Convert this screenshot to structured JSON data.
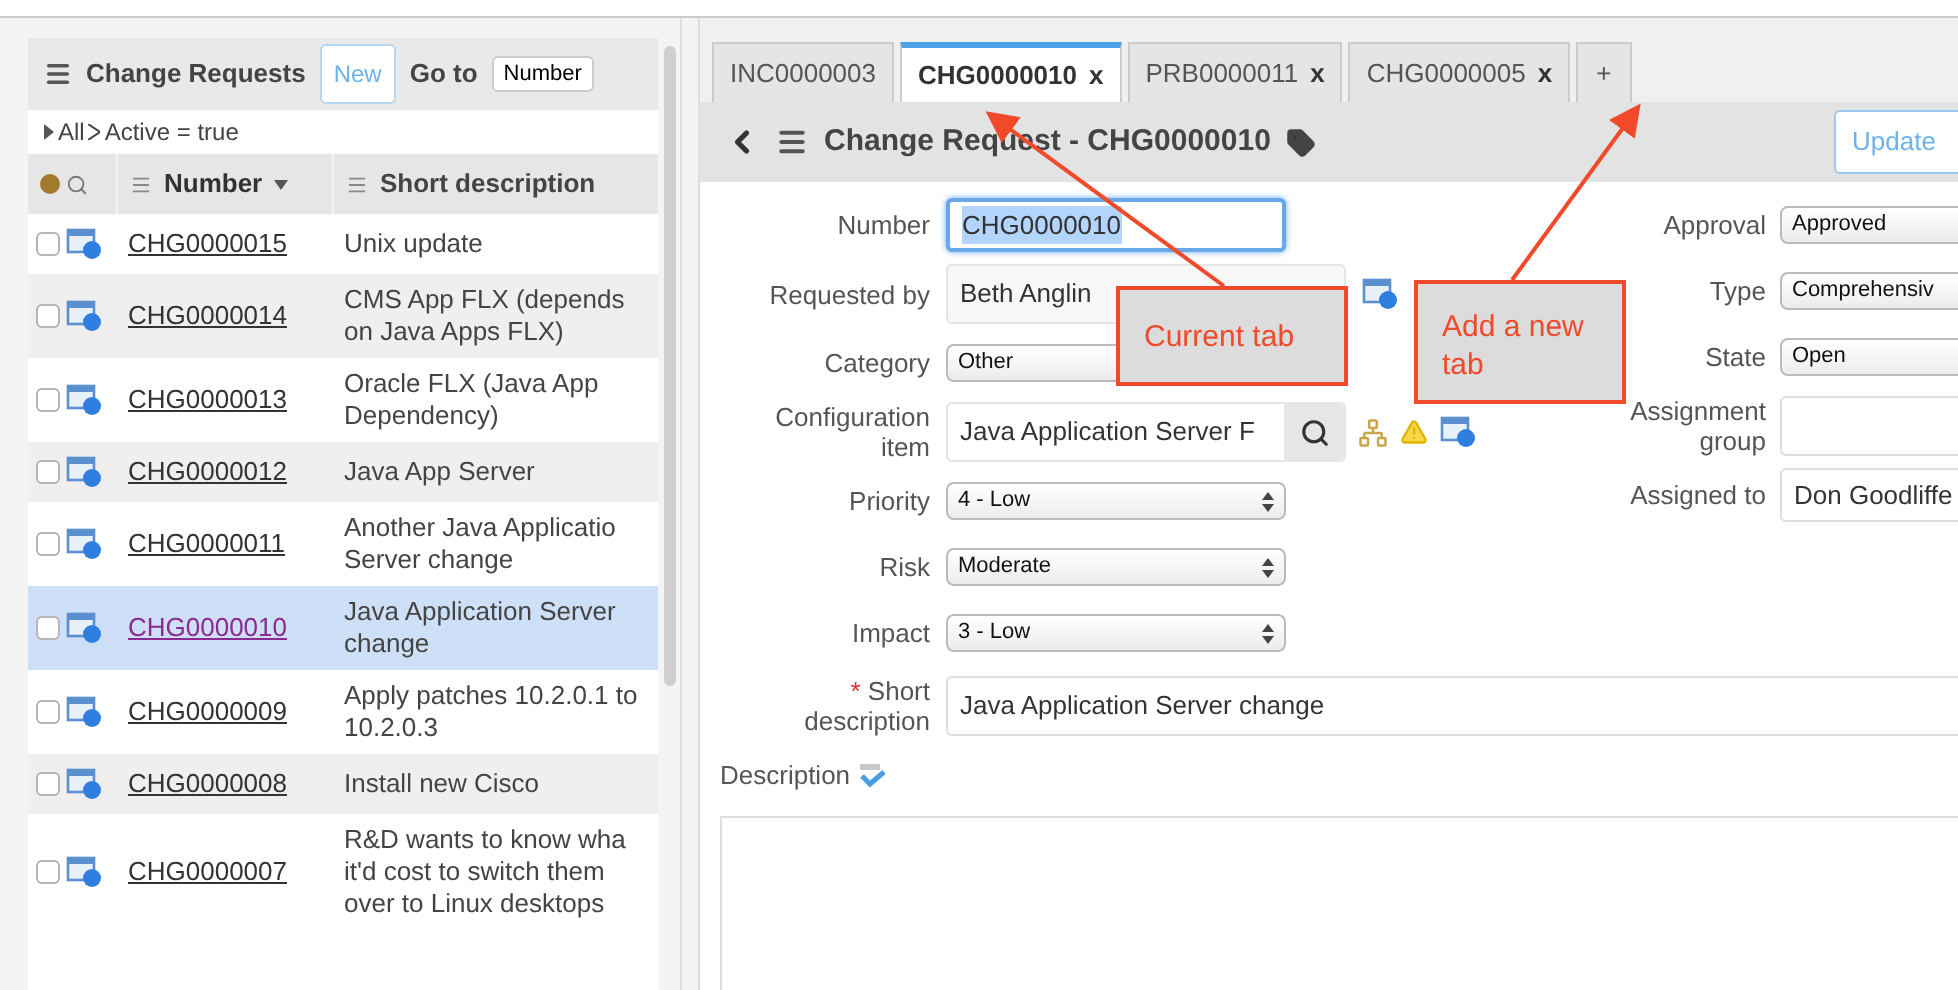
{
  "list": {
    "title": "Change Requests",
    "new_button": "New",
    "goto_label": "Go to",
    "goto_select": "Number",
    "breadcrumb": [
      {
        "label": "All"
      },
      {
        "label": "Active = true"
      }
    ],
    "columns": [
      {
        "label": "Number",
        "sorted": true
      },
      {
        "label": "Short description",
        "sorted": false
      }
    ],
    "rows": [
      {
        "number": "CHG0000015",
        "description": "Unix update",
        "selected": false
      },
      {
        "number": "CHG0000014",
        "description": "CMS App FLX (depends on Java Apps FLX)",
        "selected": false
      },
      {
        "number": "CHG0000013",
        "description": "Oracle FLX (Java App Dependency)",
        "selected": false
      },
      {
        "number": "CHG0000012",
        "description": "Java App Server",
        "selected": false
      },
      {
        "number": "CHG0000011",
        "description": "Another Java Applicatio Server change",
        "selected": false
      },
      {
        "number": "CHG0000010",
        "description": "Java Application Server change",
        "selected": true
      },
      {
        "number": "CHG0000009",
        "description": "Apply patches 10.2.0.1 to 10.2.0.3",
        "selected": false
      },
      {
        "number": "CHG0000008",
        "description": "Install new Cisco",
        "selected": false
      },
      {
        "number": "CHG0000007",
        "description": "R&D wants to know wha it'd cost to switch them over to Linux desktops",
        "selected": false
      }
    ]
  },
  "tabs": [
    {
      "label": "INC0000003",
      "selected": false
    },
    {
      "label": "CHG0000010",
      "close": "x",
      "selected": true
    },
    {
      "label": "PRB0000011",
      "close": "x",
      "selected": false
    },
    {
      "label": "CHG0000005",
      "close": "x",
      "selected": false
    }
  ],
  "add_tab": "+",
  "form": {
    "title": "Change Request - CHG0000010",
    "update_button": "Update",
    "left_fields": [
      {
        "kind": "text",
        "label": "Number",
        "value": "CHG0000010",
        "focused": true
      },
      {
        "kind": "reference",
        "label": "Requested by",
        "value": "Beth Anglin"
      },
      {
        "kind": "select",
        "label": "Category",
        "value": "Other"
      },
      {
        "kind": "lookup",
        "label": "Configuration item",
        "value": "Java Application Server F"
      },
      {
        "kind": "select",
        "label": "Priority",
        "value": "4 - Low"
      },
      {
        "kind": "select",
        "label": "Risk",
        "value": "Moderate"
      },
      {
        "kind": "select",
        "label": "Impact",
        "value": "3 - Low"
      }
    ],
    "right_fields": [
      {
        "kind": "select",
        "label": "Approval",
        "value": "Approved"
      },
      {
        "kind": "select",
        "label": "Type",
        "value": "Comprehensiv"
      },
      {
        "kind": "select",
        "label": "State",
        "value": "Open"
      },
      {
        "kind": "text",
        "label": "Assignment group"
      },
      {
        "kind": "text",
        "label": "Assigned to",
        "value": "Don Goodliffe"
      }
    ],
    "short_description": {
      "label": "Short description",
      "required_mark": "*",
      "value": "Java Application Server change"
    },
    "description_label": "Description"
  },
  "callouts": [
    {
      "text": "Current tab"
    },
    {
      "text": "Add a new tab"
    }
  ]
}
